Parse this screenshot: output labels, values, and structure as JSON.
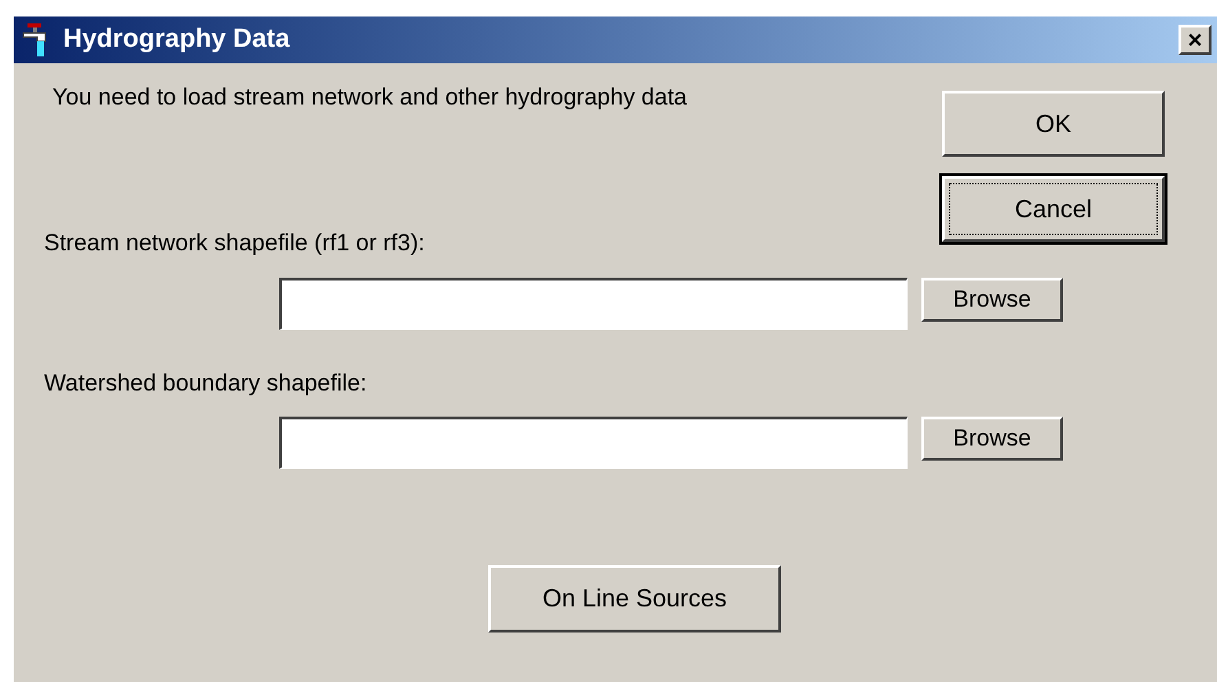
{
  "window": {
    "title": "Hydrography Data",
    "close": "×"
  },
  "message": "You need to load stream network and other hydrography data",
  "buttons": [
    {
      "label": "OK",
      "focused": false
    },
    {
      "label": "Cancel",
      "focused": true
    }
  ],
  "fields": [
    {
      "label": "Stream network shapefile (rf1 or rf3):",
      "button": "Browse"
    },
    {
      "label": "Watershed boundary shapefile:",
      "button": "Browse"
    }
  ],
  "online_button": "On Line Sources"
}
